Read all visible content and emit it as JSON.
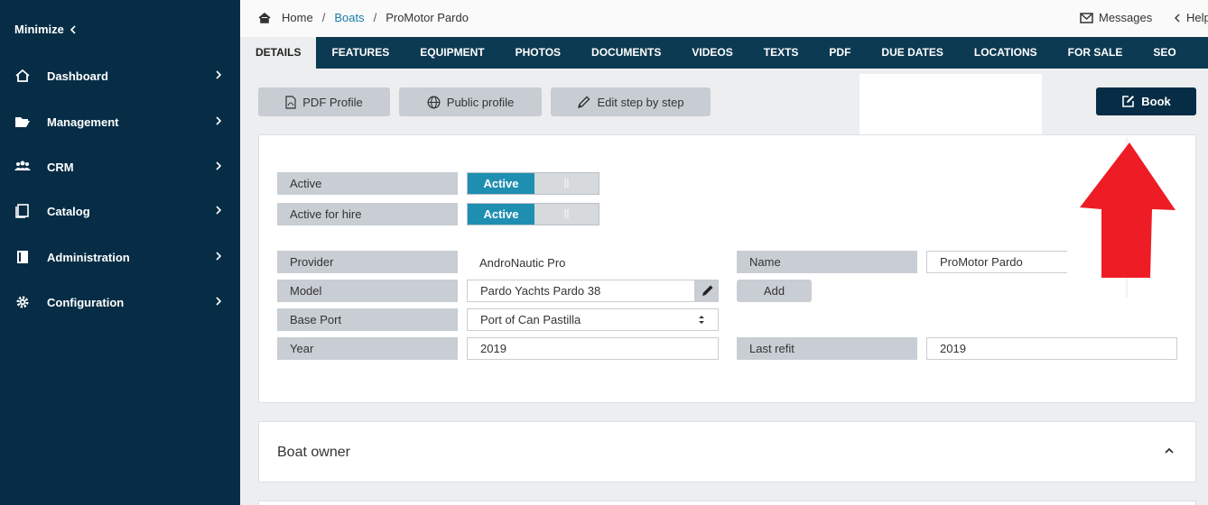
{
  "sidebar": {
    "minimize_label": "Minimize",
    "items": [
      {
        "label": "Dashboard",
        "icon": "home-icon"
      },
      {
        "label": "Management",
        "icon": "folder-open-icon"
      },
      {
        "label": "CRM",
        "icon": "users-icon"
      },
      {
        "label": "Catalog",
        "icon": "catalog-icon"
      },
      {
        "label": "Administration",
        "icon": "book-icon"
      },
      {
        "label": "Configuration",
        "icon": "gear-icon"
      }
    ]
  },
  "breadcrumb": {
    "home": "Home",
    "section": "Boats",
    "current": "ProMotor Pardo"
  },
  "topbar": {
    "messages": "Messages",
    "help": "Help"
  },
  "tabs": [
    "DETAILS",
    "FEATURES",
    "EQUIPMENT",
    "PHOTOS",
    "DOCUMENTS",
    "VIDEOS",
    "TEXTS",
    "PDF",
    "DUE DATES",
    "LOCATIONS",
    "FOR SALE",
    "SEO"
  ],
  "actions": {
    "pdf_profile": "PDF Profile",
    "public_profile": "Public profile",
    "edit_step": "Edit step by step",
    "book": "Book"
  },
  "form": {
    "active_label": "Active",
    "active_value": "Active",
    "active_off": "||",
    "hire_label": "Active for hire",
    "hire_value": "Active",
    "hire_off": "||",
    "provider_label": "Provider",
    "provider_value": "AndroNautic Pro",
    "name_label": "Name",
    "name_value": "ProMotor Pardo",
    "model_label": "Model",
    "model_value": "Pardo Yachts Pardo 38",
    "add_label": "Add",
    "base_port_label": "Base Port",
    "base_port_value": "Port of Can Pastilla",
    "year_label": "Year",
    "year_value": "2019",
    "last_refit_label": "Last refit",
    "last_refit_value": "2019"
  },
  "owner": {
    "title": "Boat owner"
  },
  "colors": {
    "sidebar": "#062d45",
    "tabs": "#0c3a52",
    "accent": "#1f8fb1",
    "arrow": "#ee1c25"
  }
}
